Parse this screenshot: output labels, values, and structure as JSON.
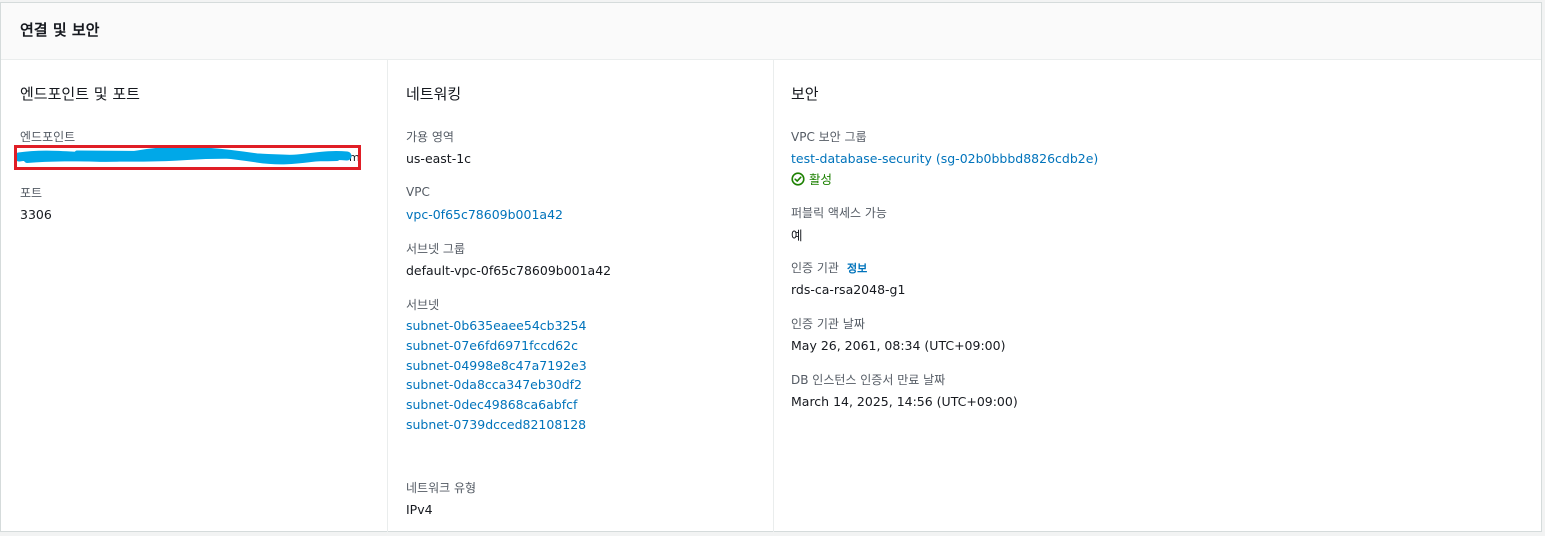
{
  "panel": {
    "title": "연결 및 보안"
  },
  "endpoints": {
    "section_title": "엔드포인트 및 포트",
    "endpoint_label": "엔드포인트",
    "endpoint_value_suffix": "m",
    "port_label": "포트",
    "port_value": "3306"
  },
  "networking": {
    "section_title": "네트워킹",
    "az_label": "가용 영역",
    "az_value": "us-east-1c",
    "vpc_label": "VPC",
    "vpc_value": "vpc-0f65c78609b001a42",
    "subnet_group_label": "서브넷 그룹",
    "subnet_group_value": "default-vpc-0f65c78609b001a42",
    "subnets_label": "서브넷",
    "subnets": [
      "subnet-0b635eaee54cb3254",
      "subnet-07e6fd6971fccd62c",
      "subnet-04998e8c47a7192e3",
      "subnet-0da8cca347eb30df2",
      "subnet-0dec49868ca6abfcf",
      "subnet-0739dcced82108128"
    ],
    "network_type_label": "네트워크 유형",
    "network_type_value": "IPv4"
  },
  "security": {
    "section_title": "보안",
    "sg_label": "VPC 보안 그룹",
    "sg_value": "test-database-security (sg-02b0bbbd8826cdb2e)",
    "sg_status": "활성",
    "sg_status_icon": "check-circle-icon",
    "sg_status_color": "#1d8102",
    "public_label": "퍼블릭 액세스 가능",
    "public_value": "예",
    "ca_label": "인증 기관",
    "ca_info": "정보",
    "ca_value": "rds-ca-rsa2048-g1",
    "ca_date_label": "인증 기관 날짜",
    "ca_date_value": "May 26, 2061, 08:34 (UTC+09:00)",
    "cert_expiry_label": "DB 인스턴스 인증서 만료 날짜",
    "cert_expiry_value": "March 14, 2025, 14:56 (UTC+09:00)"
  },
  "colors": {
    "link": "#0073bb",
    "highlight_border": "#e01e26",
    "redaction": "#00a8e8"
  }
}
